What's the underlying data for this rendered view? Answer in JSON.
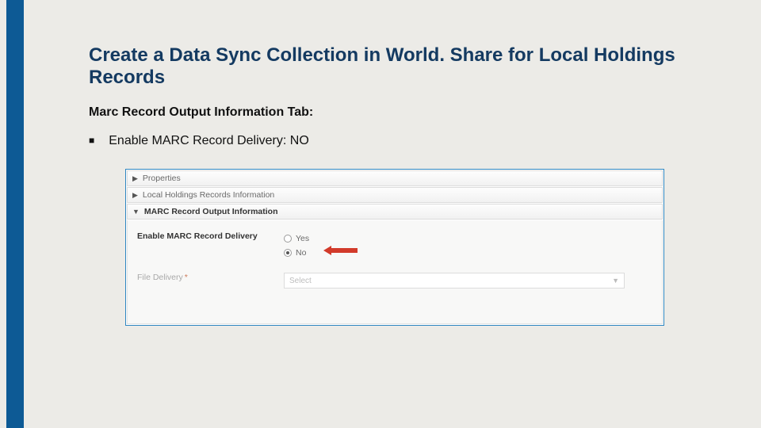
{
  "title": "Create a Data Sync Collection in World. Share for Local Holdings Records",
  "subtitle": "Marc Record Output Information Tab:",
  "bullet": "Enable MARC Record Delivery: NO",
  "panels": {
    "properties": "Properties",
    "localHoldings": "Local Holdings Records Information",
    "marcOutput": "MARC Record Output Information"
  },
  "form": {
    "enableLabel": "Enable MARC Record Delivery",
    "yes": "Yes",
    "no": "No",
    "fileDeliveryLabel": "File Delivery",
    "selectPlaceholder": "Select"
  }
}
